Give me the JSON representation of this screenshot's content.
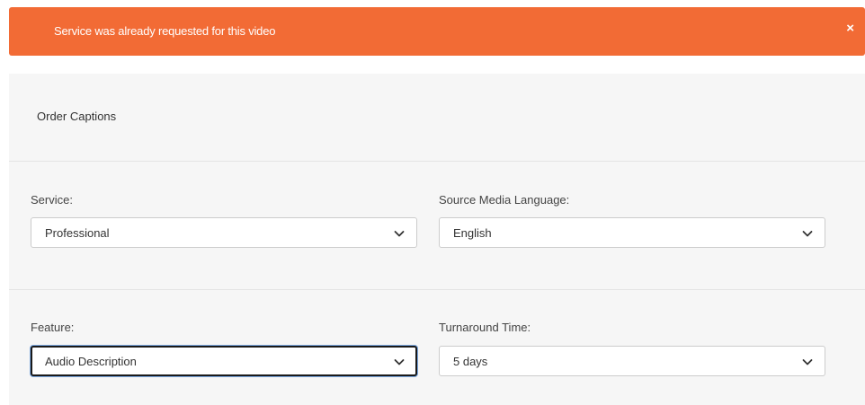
{
  "alert": {
    "message": "Service was already requested for this video",
    "close_glyph": "×",
    "color": "#f26b35"
  },
  "panel": {
    "title": "Order Captions"
  },
  "fields": {
    "service": {
      "label": "Service:",
      "value": "Professional"
    },
    "source_language": {
      "label": "Source Media Language:",
      "value": "English"
    },
    "feature": {
      "label": "Feature:",
      "value": "Audio Description"
    },
    "turnaround": {
      "label": "Turnaround Time:",
      "value": "5 days"
    }
  },
  "icons": {
    "dropdown": "chevron-down-icon",
    "close": "close-icon"
  }
}
